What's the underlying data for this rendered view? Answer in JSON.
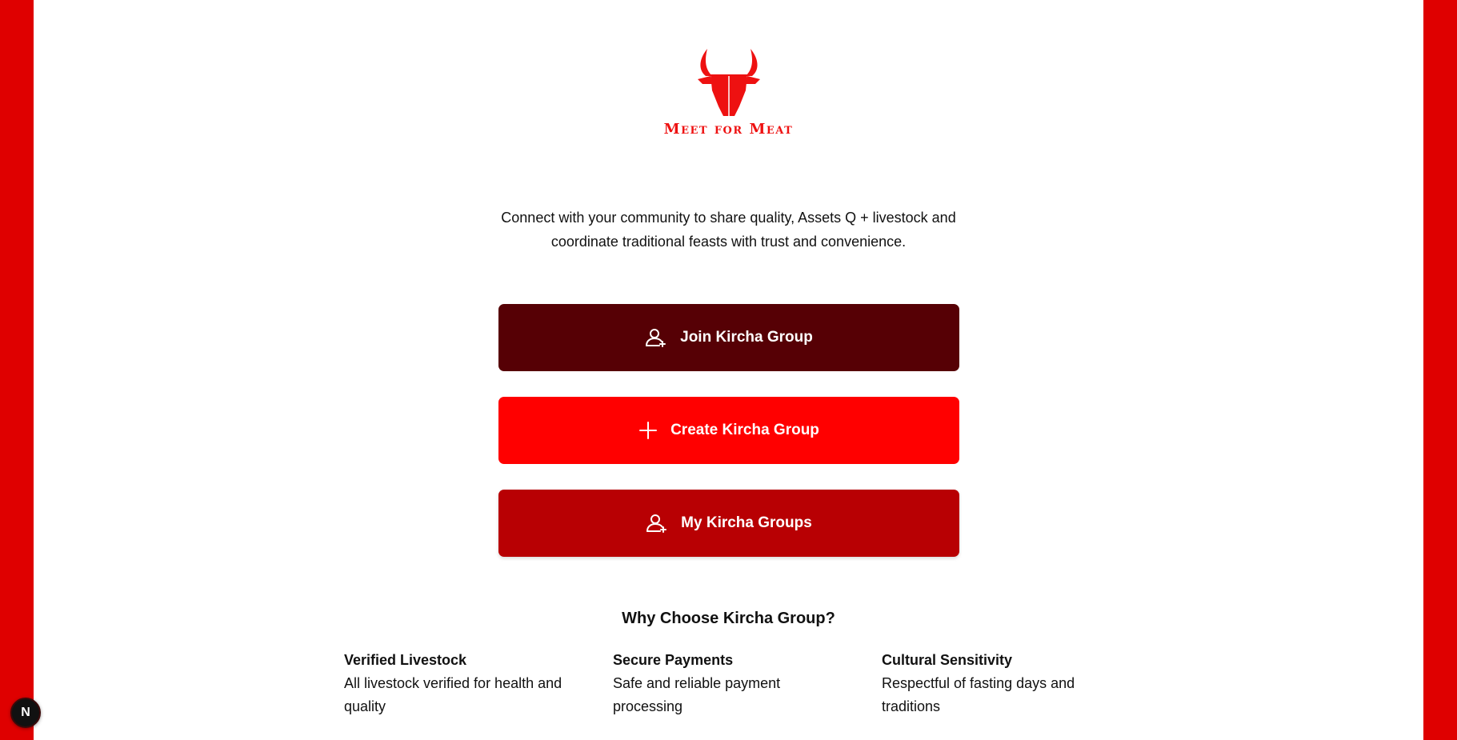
{
  "brand": {
    "name": "Meet for Meat"
  },
  "tagline": {
    "line1": "Connect with your community to share quality, Assets Q + livestock and",
    "line2": "coordinate traditional feasts with trust and convenience."
  },
  "actions": {
    "join_label": "Join Kircha Group",
    "create_label": "Create Kircha Group",
    "my_label": "My Kircha Groups"
  },
  "why": {
    "title": "Why Choose Kircha Group?",
    "features": [
      {
        "title": "Verified Livestock",
        "text": "All livestock verified for health and quality"
      },
      {
        "title": "Secure Payments",
        "text": "Safe and reliable payment processing"
      },
      {
        "title": "Cultural Sensitivity",
        "text": "Respectful of fasting days and traditions"
      }
    ]
  },
  "dev_badge": {
    "letter": "N"
  },
  "colors": {
    "side_bar": "#df0000",
    "join_button": "#560005",
    "create_button": "#ff0000",
    "my_button": "#b80003",
    "logo": "#ee1111"
  },
  "icons": {
    "logo": "bull-head-icon",
    "join": "user-add-icon",
    "create": "plus-icon",
    "my": "user-group-icon"
  }
}
